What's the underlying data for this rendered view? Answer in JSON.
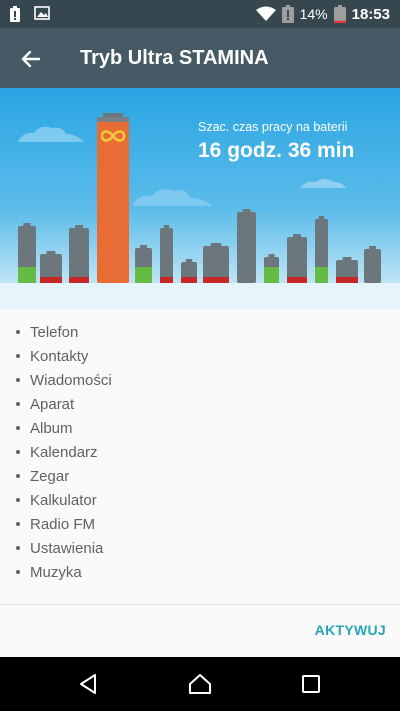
{
  "status_bar": {
    "notification_icons": [
      "battery-alert-icon",
      "image-icon"
    ],
    "battery_percent": "14%",
    "battery_level": 0.14,
    "time": "18:53"
  },
  "app_bar": {
    "title": "Tryb Ultra STAMINA",
    "back_icon": "arrow-back-icon"
  },
  "hero": {
    "estimate_label": "Szac. czas pracy na baterii",
    "estimate_value": "16 godz. 36 min",
    "colors": {
      "sky_top": "#2aa5e3",
      "sky_bottom": "#e3f4fb",
      "building": "#6b767d",
      "highlight_building": "#e86d35",
      "accent_green": "#66bb45",
      "accent_red": "#c62828",
      "infinity": "#f4c73c"
    }
  },
  "apps": [
    "Telefon",
    "Kontakty",
    "Wiadomości",
    "Aparat",
    "Album",
    "Kalendarz",
    "Zegar",
    "Kalkulator",
    "Radio FM",
    "Ustawienia",
    "Muzyka"
  ],
  "footer": {
    "activate_label": "AKTYWUJ",
    "accent": "#26a6b5"
  },
  "nav_bar": {
    "icons": [
      "back-triangle-icon",
      "home-icon",
      "recents-icon"
    ]
  }
}
